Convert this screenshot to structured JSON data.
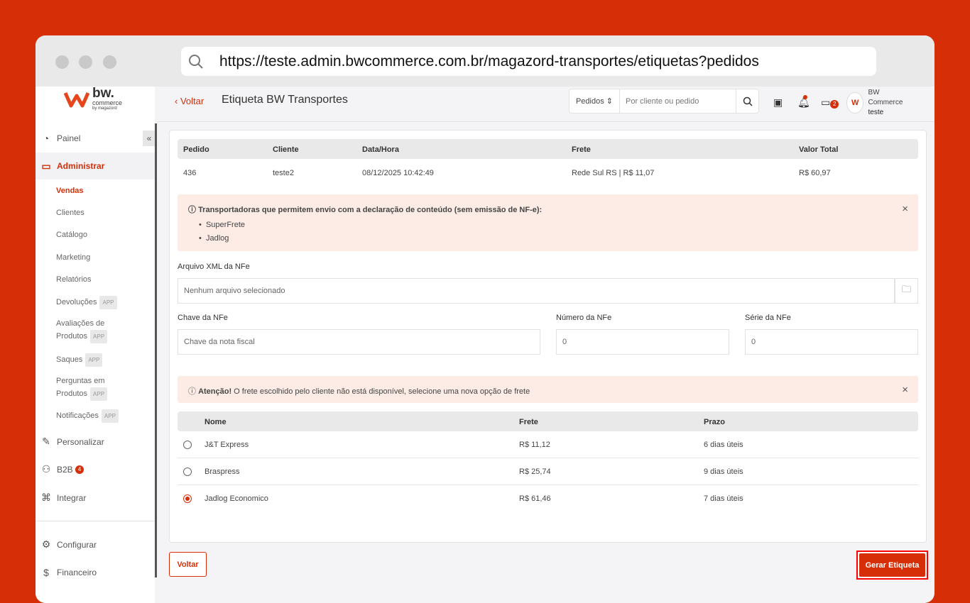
{
  "browser": {
    "url": "https://teste.admin.bwcommerce.com.br/magazord-transportes/etiquetas?pedidos"
  },
  "logo": {
    "text": "bw.",
    "sub": "commerce",
    "by": "by magazord"
  },
  "sidebar": {
    "items": [
      {
        "label": "Painel",
        "icon": "pie-chart-icon"
      },
      {
        "label": "Administrar",
        "icon": "monitor-icon"
      },
      {
        "label": "Personalizar",
        "icon": "pencil-icon"
      },
      {
        "label": "B2B",
        "icon": "users-icon",
        "badge": "4"
      },
      {
        "label": "Integrar",
        "icon": "command-icon"
      },
      {
        "label": "Configurar",
        "icon": "gear-icon"
      },
      {
        "label": "Financeiro",
        "icon": "dollar-icon"
      }
    ],
    "sub": [
      {
        "label": "Vendas"
      },
      {
        "label": "Clientes"
      },
      {
        "label": "Catálogo"
      },
      {
        "label": "Marketing"
      },
      {
        "label": "Relatórios"
      },
      {
        "label": "Devoluções",
        "tag": "APP"
      },
      {
        "label": "Avaliações de",
        "label2": "Produtos",
        "tag": "APP"
      },
      {
        "label": "Saques",
        "tag": "APP"
      },
      {
        "label": "Perguntas em",
        "label2": "Produtos",
        "tag": "APP"
      },
      {
        "label": "Notificações",
        "tag": "APP"
      }
    ]
  },
  "header": {
    "back": "Voltar",
    "title": "Etiqueta BW Transportes",
    "search_select": "Pedidos",
    "search_placeholder": "Por cliente ou pedido",
    "messages_badge": "2",
    "user_company": "BW Commerce",
    "user_name": "teste"
  },
  "order": {
    "headers": [
      "Pedido",
      "Cliente",
      "Data/Hora",
      "Frete",
      "Valor Total"
    ],
    "values": [
      "436",
      "teste2",
      "08/12/2025 10:42:49",
      "Rede Sul RS | R$ 11,07",
      "R$ 60,97"
    ]
  },
  "info_alert": {
    "text": "Transportadoras que permitem envio com a declaração de conteúdo (sem emissão de NF-e):",
    "items": [
      "SuperFrete",
      "Jadlog"
    ]
  },
  "form": {
    "xml_label": "Arquivo XML da NFe",
    "xml_value": "Nenhum arquivo selecionado",
    "chave_label": "Chave da NFe",
    "chave_placeholder": "Chave da nota fiscal",
    "numero_label": "Número da NFe",
    "numero_value": "0",
    "serie_label": "Série da NFe",
    "serie_value": "0"
  },
  "warning": {
    "strong": "Atenção!",
    "text": " O frete escolhido pelo cliente não está disponível, selecione uma nova opção de frete"
  },
  "shipping": {
    "headers": [
      "Nome",
      "Frete",
      "Prazo"
    ],
    "rows": [
      {
        "name": "J&T Express",
        "price": "R$ 11,12",
        "term": "6 dias úteis",
        "selected": false
      },
      {
        "name": "Braspress",
        "price": "R$ 25,74",
        "term": "9 dias úteis",
        "selected": false
      },
      {
        "name": "Jadlog Economico",
        "price": "R$ 61,46",
        "term": "7 dias úteis",
        "selected": true
      }
    ]
  },
  "actions": {
    "back": "Voltar",
    "generate": "Gerar Etiqueta"
  }
}
